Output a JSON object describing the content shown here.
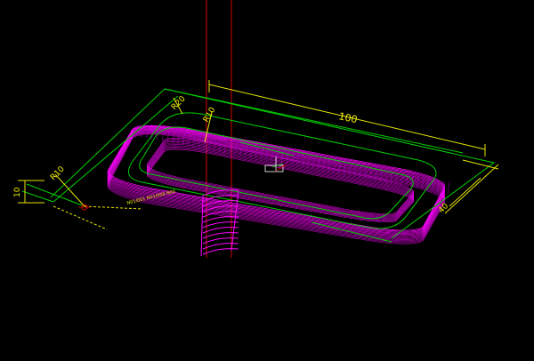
{
  "colors": {
    "background": "#000000",
    "toolpath": "#ff00ff",
    "toolpath_dim": "#b000c8",
    "dimension_green": "#00d000",
    "dimension_yellow": "#e6e600",
    "axis_red": "#d00000",
    "link_teal": "#00b0a0"
  },
  "dimensions": {
    "length": "100",
    "depth": "10",
    "radius_outer_left": "R10",
    "radius_outer_back": "R20",
    "radius_inner": "R10",
    "width_right": "40"
  },
  "annotation": {
    "note": "N01/001 N01/000 N00"
  },
  "icons": {
    "origin": "origin-axis-icon",
    "tool_axis": "tool-axis-icon"
  }
}
